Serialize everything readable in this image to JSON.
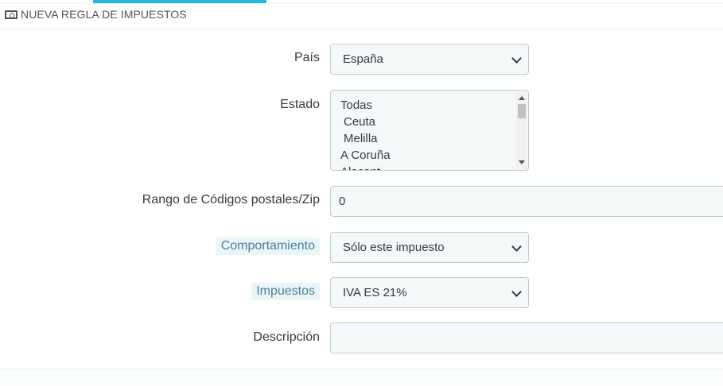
{
  "panel": {
    "title": "NUEVA REGLA DE IMPUESTOS",
    "icon": "money-icon"
  },
  "form": {
    "country": {
      "label": "País",
      "value": "España"
    },
    "state": {
      "label": "Estado",
      "options": [
        "Todas",
        "Ceuta",
        "Melilla",
        "A Coruña",
        "Alacant"
      ]
    },
    "zip": {
      "label": "Rango de Códigos postales/Zip",
      "value": "0"
    },
    "behavior": {
      "label": "Comportamiento",
      "value": "Sólo este impuesto"
    },
    "tax": {
      "label": "Impuestos",
      "value": "IVA ES 21%"
    },
    "description": {
      "label": "Descripción",
      "value": ""
    }
  },
  "colors": {
    "accent": "#25b9d7",
    "field_bg": "#f5f8f9",
    "field_border": "#bbcdd2",
    "help_label_bg": "#eaf5f8",
    "help_label_text": "#4a7f95"
  }
}
